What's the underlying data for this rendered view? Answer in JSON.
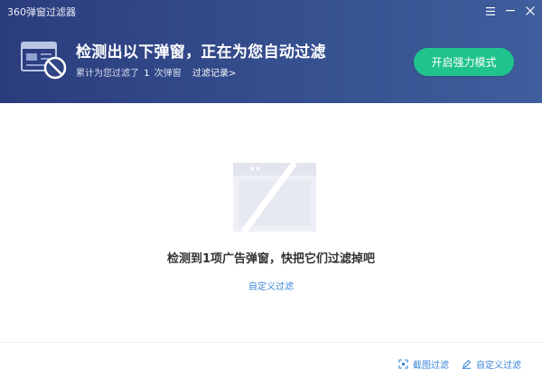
{
  "window": {
    "title": "360弹窗过滤器"
  },
  "header": {
    "headline": "检测出以下弹窗，正在为您自动过滤",
    "sub_prefix": "累计为您过滤了",
    "sub_count": "1",
    "sub_suffix": "次弹窗",
    "record_link": "过滤记录>",
    "power_button": "开启强力模式"
  },
  "main": {
    "empty_message": "检测到1项广告弹窗，快把它们过滤掉吧",
    "custom_filter_link": "自定义过滤"
  },
  "footer": {
    "screenshot_filter": "截图过滤",
    "custom_filter": "自定义过滤"
  },
  "colors": {
    "header_start": "#2b3c7d",
    "header_end": "#3f5e9d",
    "accent_green": "#20c38d",
    "link_blue": "#3b86d8"
  },
  "icons": {
    "menu": "menu-icon",
    "minimize": "minimize-icon",
    "close": "close-icon",
    "hero": "blocked-window-icon",
    "illustration": "empty-window-illustration",
    "screenshot": "screenshot-crop-icon",
    "edit": "pencil-edit-icon"
  }
}
